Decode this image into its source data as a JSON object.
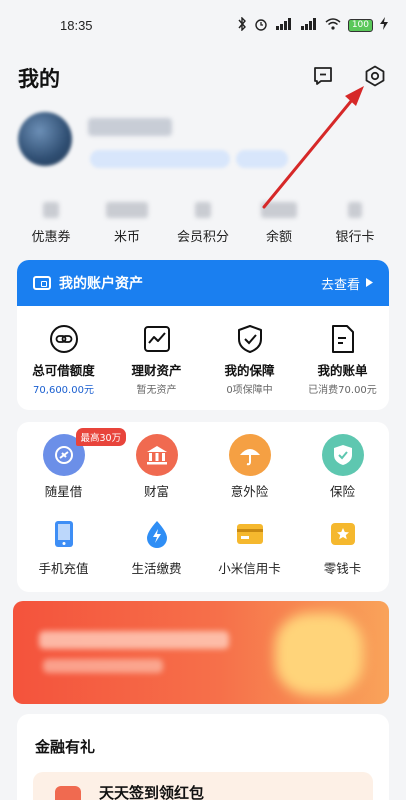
{
  "status_bar": {
    "time": "18:35",
    "icons": [
      "bluetooth-icon",
      "alarm-icon",
      "signal-icon",
      "signal-icon",
      "wifi-icon"
    ],
    "battery": "100"
  },
  "header": {
    "title": "我的",
    "actions": [
      "message-icon",
      "settings-icon"
    ]
  },
  "stats": [
    {
      "label": "优惠券"
    },
    {
      "label": "米币"
    },
    {
      "label": "会员积分"
    },
    {
      "label": "余额"
    },
    {
      "label": "银行卡"
    }
  ],
  "asset_card": {
    "title": "我的账户资产",
    "link": "去查看",
    "items": [
      {
        "label": "总可借额度",
        "sub": "70,600.00元",
        "icon": "link-icon"
      },
      {
        "label": "理财资产",
        "sub": "暂无资产",
        "icon": "trend-chart-icon"
      },
      {
        "label": "我的保障",
        "sub": "0项保障中",
        "icon": "shield-check-icon"
      },
      {
        "label": "我的账单",
        "sub": "已消费70.00元",
        "icon": "bill-icon"
      }
    ]
  },
  "services": {
    "row1": [
      {
        "label": "随星借",
        "badge": "最高30万",
        "icon": "loan-icon",
        "color": "#6b8fe8"
      },
      {
        "label": "财富",
        "icon": "bank-icon",
        "color": "#f06a50"
      },
      {
        "label": "意外险",
        "icon": "umbrella-icon",
        "color": "#f5a043"
      },
      {
        "label": "保险",
        "icon": "shield-icon",
        "color": "#5ec7b0"
      }
    ],
    "row2": [
      {
        "label": "手机充值",
        "icon": "phone-icon",
        "color": "#3e8ef5"
      },
      {
        "label": "生活缴费",
        "icon": "bolt-icon",
        "color": "#2f8ef5"
      },
      {
        "label": "小米信用卡",
        "icon": "card-icon",
        "color": "#f5b82e"
      },
      {
        "label": "零钱卡",
        "icon": "star-card-icon",
        "color": "#f5b82e"
      }
    ]
  },
  "finance": {
    "title": "金融有礼",
    "item_label": "天天签到领红包"
  }
}
